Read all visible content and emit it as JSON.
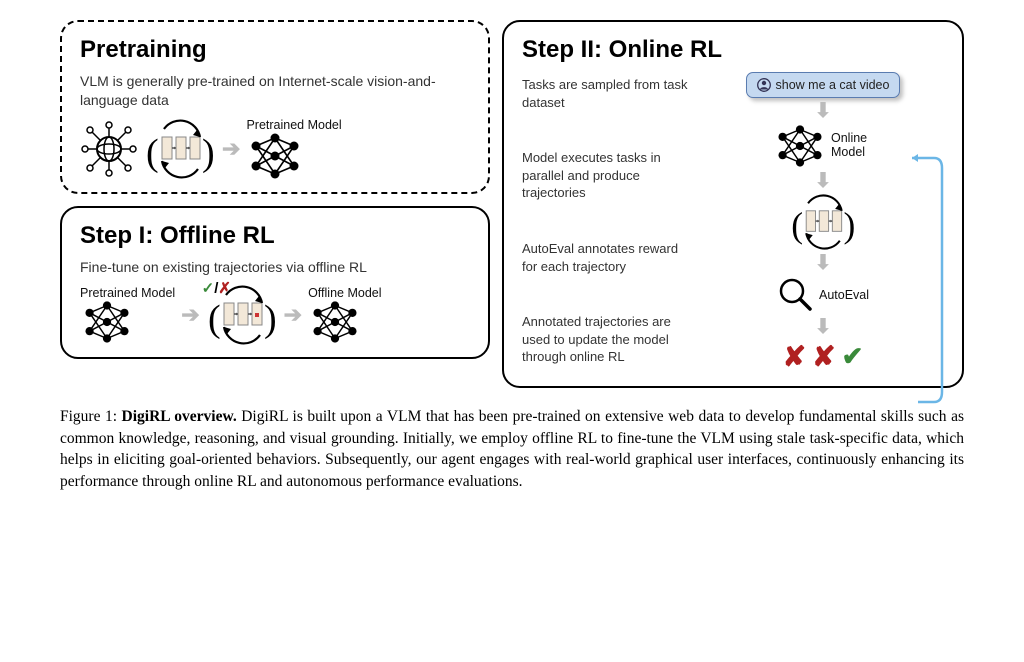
{
  "pretrain": {
    "title": "Pretraining",
    "desc": "VLM is generally pre-trained on Internet-scale vision-and-language data",
    "out_label": "Pretrained Model"
  },
  "step1": {
    "title": "Step I: Offline RL",
    "desc": "Fine-tune on existing trajectories via offline RL",
    "in_label": "Pretrained Model",
    "out_label": "Offline Model",
    "check": "✓",
    "slash": "/",
    "x": "✗"
  },
  "step2": {
    "title": "Step II: Online RL",
    "t1": "Tasks are sampled from task dataset",
    "t2": "Model executes tasks in parallel and produce trajectories",
    "t3": "AutoEval annotates reward for each trajectory",
    "t4": "Annotated trajectories are used to update the model through online RL",
    "prompt": "show me a cat video",
    "model_label": "Online Model",
    "eval_label": "AutoEval"
  },
  "caption": {
    "label": "Figure 1: ",
    "title": "DigiRL overview.",
    "body": " DigiRL is built upon a VLM that has been pre-trained on extensive web data to develop fundamental skills such as common knowledge, reasoning, and visual grounding. Initially, we employ offline RL to fine-tune the VLM using stale task-specific data, which helps in eliciting goal-oriented behaviors. Subsequently, our agent engages with real-world graphical user interfaces, continuously enhancing its performance through online RL and autonomous performance evaluations."
  }
}
